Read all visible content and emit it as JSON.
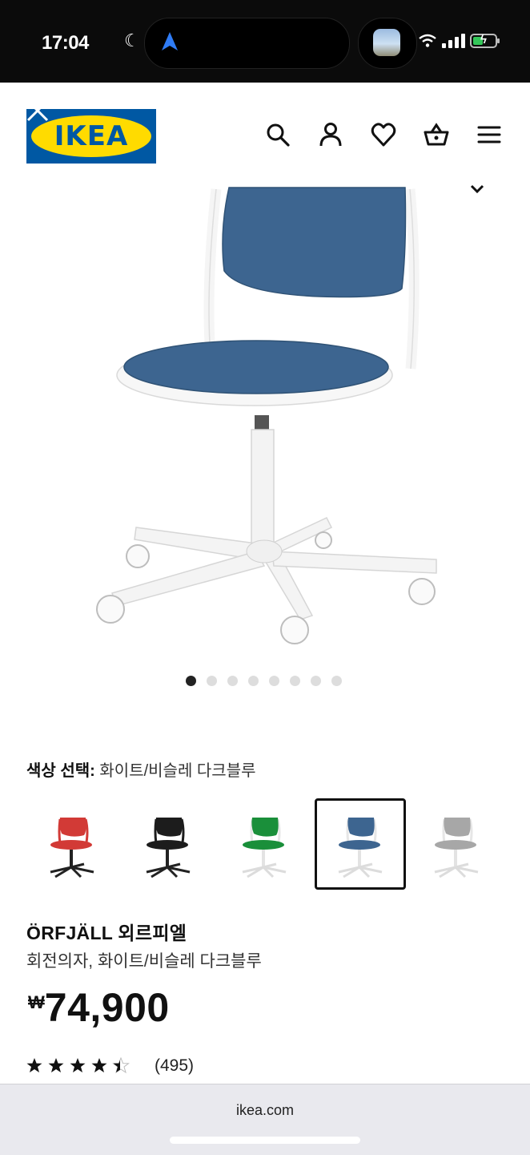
{
  "status_bar": {
    "time": "17:04",
    "moon_icon": "moon-icon",
    "nav_icon": "location-arrow-icon"
  },
  "header": {
    "logo_text": "IKEA",
    "icons": [
      "search-icon",
      "user-icon",
      "heart-icon",
      "basket-icon",
      "menu-icon"
    ],
    "brand_colors": {
      "blue": "#0058a3",
      "yellow": "#ffdb00"
    }
  },
  "gallery": {
    "image_count": 8,
    "active_index": 0,
    "seat_color": "#3d6590"
  },
  "color_selection": {
    "label": "색상 선택:",
    "value": "화이트/비슬레 다크블루",
    "swatches": [
      {
        "seat": "#d23a36",
        "frame": "#222222",
        "selected": false
      },
      {
        "seat": "#1c1c1c",
        "frame": "#222222",
        "selected": false
      },
      {
        "seat": "#1a8f3a",
        "frame": "#e6e6e6",
        "selected": false
      },
      {
        "seat": "#3d6590",
        "frame": "#e6e6e6",
        "selected": true
      },
      {
        "seat": "#a7a7a7",
        "frame": "#e6e6e6",
        "selected": false
      }
    ]
  },
  "product": {
    "name": "ÖRFJÄLL 외르피엘",
    "description": "회전의자, 화이트/비슬레 다크블루",
    "currency": "₩",
    "price": "74,900",
    "rating": 4.5,
    "review_count": "(495)"
  },
  "browser": {
    "url": "ikea.com"
  }
}
